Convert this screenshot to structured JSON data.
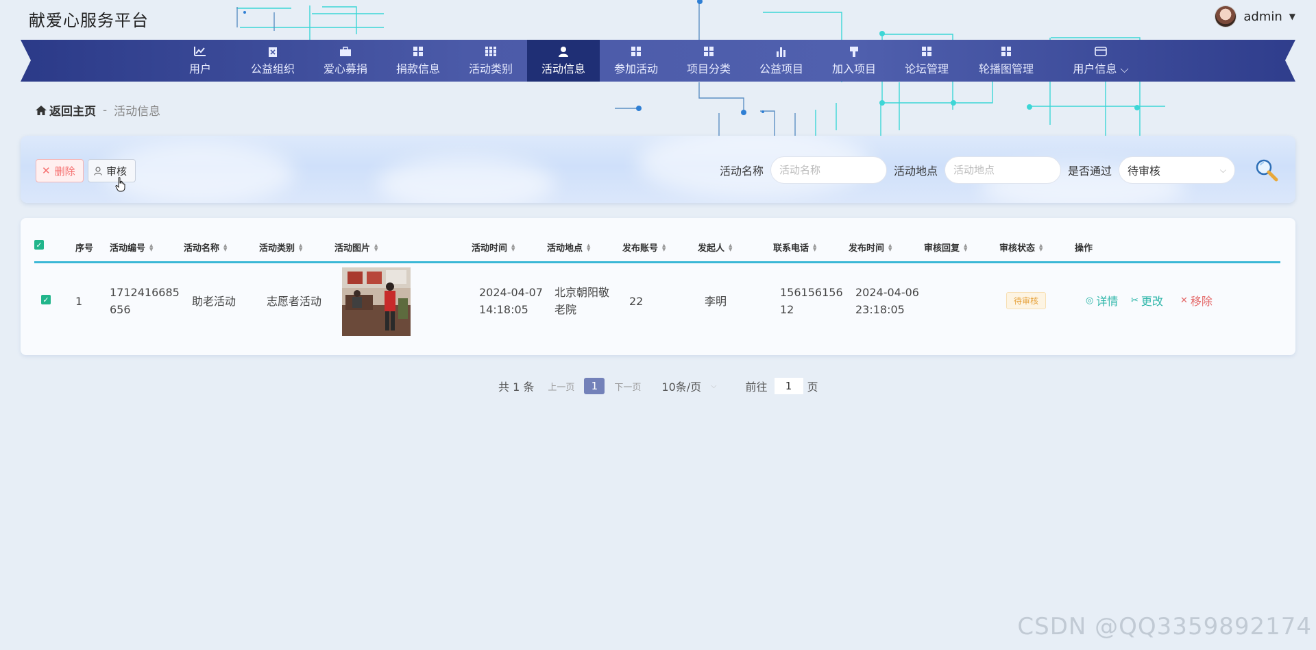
{
  "header": {
    "site_title": "献爱心服务平台",
    "user_name": "admin"
  },
  "nav": {
    "items": [
      {
        "label": "用户",
        "icon": "chart-icon"
      },
      {
        "label": "公益组织",
        "icon": "clipboard-icon"
      },
      {
        "label": "爱心募捐",
        "icon": "briefcase-icon"
      },
      {
        "label": "捐款信息",
        "icon": "grid-icon"
      },
      {
        "label": "活动类别",
        "icon": "grid-dots-icon"
      },
      {
        "label": "活动信息",
        "icon": "person-icon",
        "active": true
      },
      {
        "label": "参加活动",
        "icon": "grid-icon"
      },
      {
        "label": "项目分类",
        "icon": "grid-icon"
      },
      {
        "label": "公益项目",
        "icon": "bar-chart-icon"
      },
      {
        "label": "加入项目",
        "icon": "brush-icon"
      },
      {
        "label": "论坛管理",
        "icon": "grid-icon"
      },
      {
        "label": "轮播图管理",
        "icon": "grid-icon"
      },
      {
        "label": "用户信息",
        "icon": "card-icon"
      }
    ]
  },
  "breadcrumb": {
    "home": "返回主页",
    "separator": "-",
    "current": "活动信息"
  },
  "toolbar": {
    "delete_label": "删除",
    "audit_label": "审核"
  },
  "search": {
    "name_label": "活动名称",
    "name_placeholder": "活动名称",
    "place_label": "活动地点",
    "place_placeholder": "活动地点",
    "pass_label": "是否通过",
    "pass_value": "待审核"
  },
  "table": {
    "headers": [
      "序号",
      "活动编号",
      "活动名称",
      "活动类别",
      "活动图片",
      "活动时间",
      "活动地点",
      "发布账号",
      "发起人",
      "联系电话",
      "发布时间",
      "审核回复",
      "审核状态",
      "操作"
    ],
    "rows": [
      {
        "index": "1",
        "code_line1": "1712416685",
        "code_line2": "656",
        "name": "助老活动",
        "category": "志愿者活动",
        "time_line1": "2024-04-07",
        "time_line2": "14:18:05",
        "place_line1": "北京朝阳敬",
        "place_line2": "老院",
        "account": "22",
        "initiator": "李明",
        "phone_line1": "156156156",
        "phone_line2": "12",
        "publish_line1": "2024-04-06",
        "publish_line2": "23:18:05",
        "reply": "",
        "status": "待审核",
        "actions": {
          "detail": "详情",
          "edit": "更改",
          "remove": "移除"
        }
      }
    ]
  },
  "pagination": {
    "total": "共 1 条",
    "prev": "上一页",
    "current": "1",
    "next": "下一页",
    "page_size": "10条/页",
    "goto_label": "前往",
    "goto_value": "1",
    "page_suffix": "页"
  },
  "watermark": "CSDN @QQ3359892174",
  "colors": {
    "nav_bg": "#3a4a9a",
    "nav_active": "#1f2f75",
    "accent_line": "#3bb7d6",
    "status_badge": "#e6a23c",
    "delete_red": "#f56c6c",
    "action_teal": "#2bb5a8"
  }
}
